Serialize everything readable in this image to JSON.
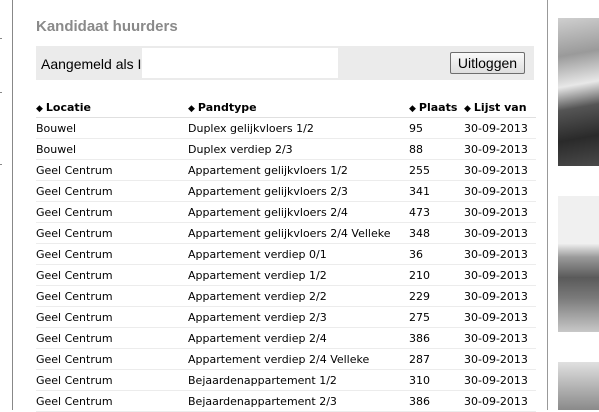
{
  "header": {
    "title": "Kandidaat huurders"
  },
  "login": {
    "label": "Aangemeld als I",
    "logout_label": "Uitloggen"
  },
  "table": {
    "columns": [
      "Locatie",
      "Pandtype",
      "Plaats",
      "Lijst van"
    ],
    "rows": [
      [
        "Bouwel",
        "Duplex gelijkvloers 1/2",
        "95",
        "30-09-2013"
      ],
      [
        "Bouwel",
        "Duplex verdiep 2/3",
        "88",
        "30-09-2013"
      ],
      [
        "Geel Centrum",
        "Appartement gelijkvloers 1/2",
        "255",
        "30-09-2013"
      ],
      [
        "Geel Centrum",
        "Appartement gelijkvloers 2/3",
        "341",
        "30-09-2013"
      ],
      [
        "Geel Centrum",
        "Appartement gelijkvloers 2/4",
        "473",
        "30-09-2013"
      ],
      [
        "Geel Centrum",
        "Appartement gelijkvloers 2/4 Velleke",
        "348",
        "30-09-2013"
      ],
      [
        "Geel Centrum",
        "Appartement verdiep 0/1",
        "36",
        "30-09-2013"
      ],
      [
        "Geel Centrum",
        "Appartement verdiep 1/2",
        "210",
        "30-09-2013"
      ],
      [
        "Geel Centrum",
        "Appartement verdiep 2/2",
        "229",
        "30-09-2013"
      ],
      [
        "Geel Centrum",
        "Appartement verdiep 2/3",
        "275",
        "30-09-2013"
      ],
      [
        "Geel Centrum",
        "Appartement verdiep 2/4",
        "386",
        "30-09-2013"
      ],
      [
        "Geel Centrum",
        "Appartement verdiep 2/4 Velleke",
        "287",
        "30-09-2013"
      ],
      [
        "Geel Centrum",
        "Bejaardenappartement 1/2",
        "310",
        "30-09-2013"
      ],
      [
        "Geel Centrum",
        "Bejaardenappartement 2/3",
        "386",
        "30-09-2013"
      ]
    ]
  },
  "icons": {
    "sort": "sort-arrows-icon"
  },
  "colors": {
    "heading": "#8a8a8a",
    "login_bar": "#ebebeb"
  }
}
